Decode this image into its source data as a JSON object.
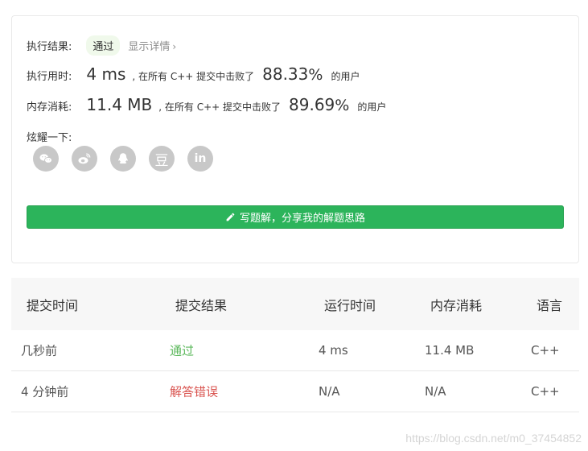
{
  "result": {
    "label": "执行结果:",
    "status": "通过",
    "detail_link": "显示详情",
    "chevron": "›"
  },
  "runtime": {
    "label": "执行用时:",
    "value": "4 ms",
    "mid_text": ", 在所有 C++ 提交中击败了",
    "percent": "88.33",
    "percent_sign": "%",
    "suffix": "的用户"
  },
  "memory": {
    "label": "内存消耗:",
    "value": "11.4 MB",
    "mid_text": ", 在所有 C++ 提交中击败了",
    "percent": "89.69",
    "percent_sign": "%",
    "suffix": "的用户"
  },
  "share": {
    "label": "炫耀一下:",
    "douban_glyph": "豆",
    "linkedin_glyph": "in",
    "icons": [
      "wechat-icon",
      "weibo-icon",
      "qq-icon",
      "douban-icon",
      "linkedin-icon"
    ]
  },
  "write_solution_label": "写题解，分享我的解题思路",
  "submissions": {
    "headers": [
      "提交时间",
      "提交结果",
      "运行时间",
      "内存消耗",
      "语言"
    ],
    "rows": [
      {
        "time": "几秒前",
        "result": "通过",
        "runtime": "4 ms",
        "memory": "11.4 MB",
        "lang": "C++"
      },
      {
        "time": "4 分钟前",
        "result": "解答错误",
        "runtime": "N/A",
        "memory": "N/A",
        "lang": "C++"
      }
    ]
  },
  "watermark": "https://blog.csdn.net/m0_37454852",
  "colors": {
    "accent": "#2cb45b",
    "ok": "#5cb85c",
    "error": "#d9534f",
    "icon_bg": "#c8c8c8"
  }
}
